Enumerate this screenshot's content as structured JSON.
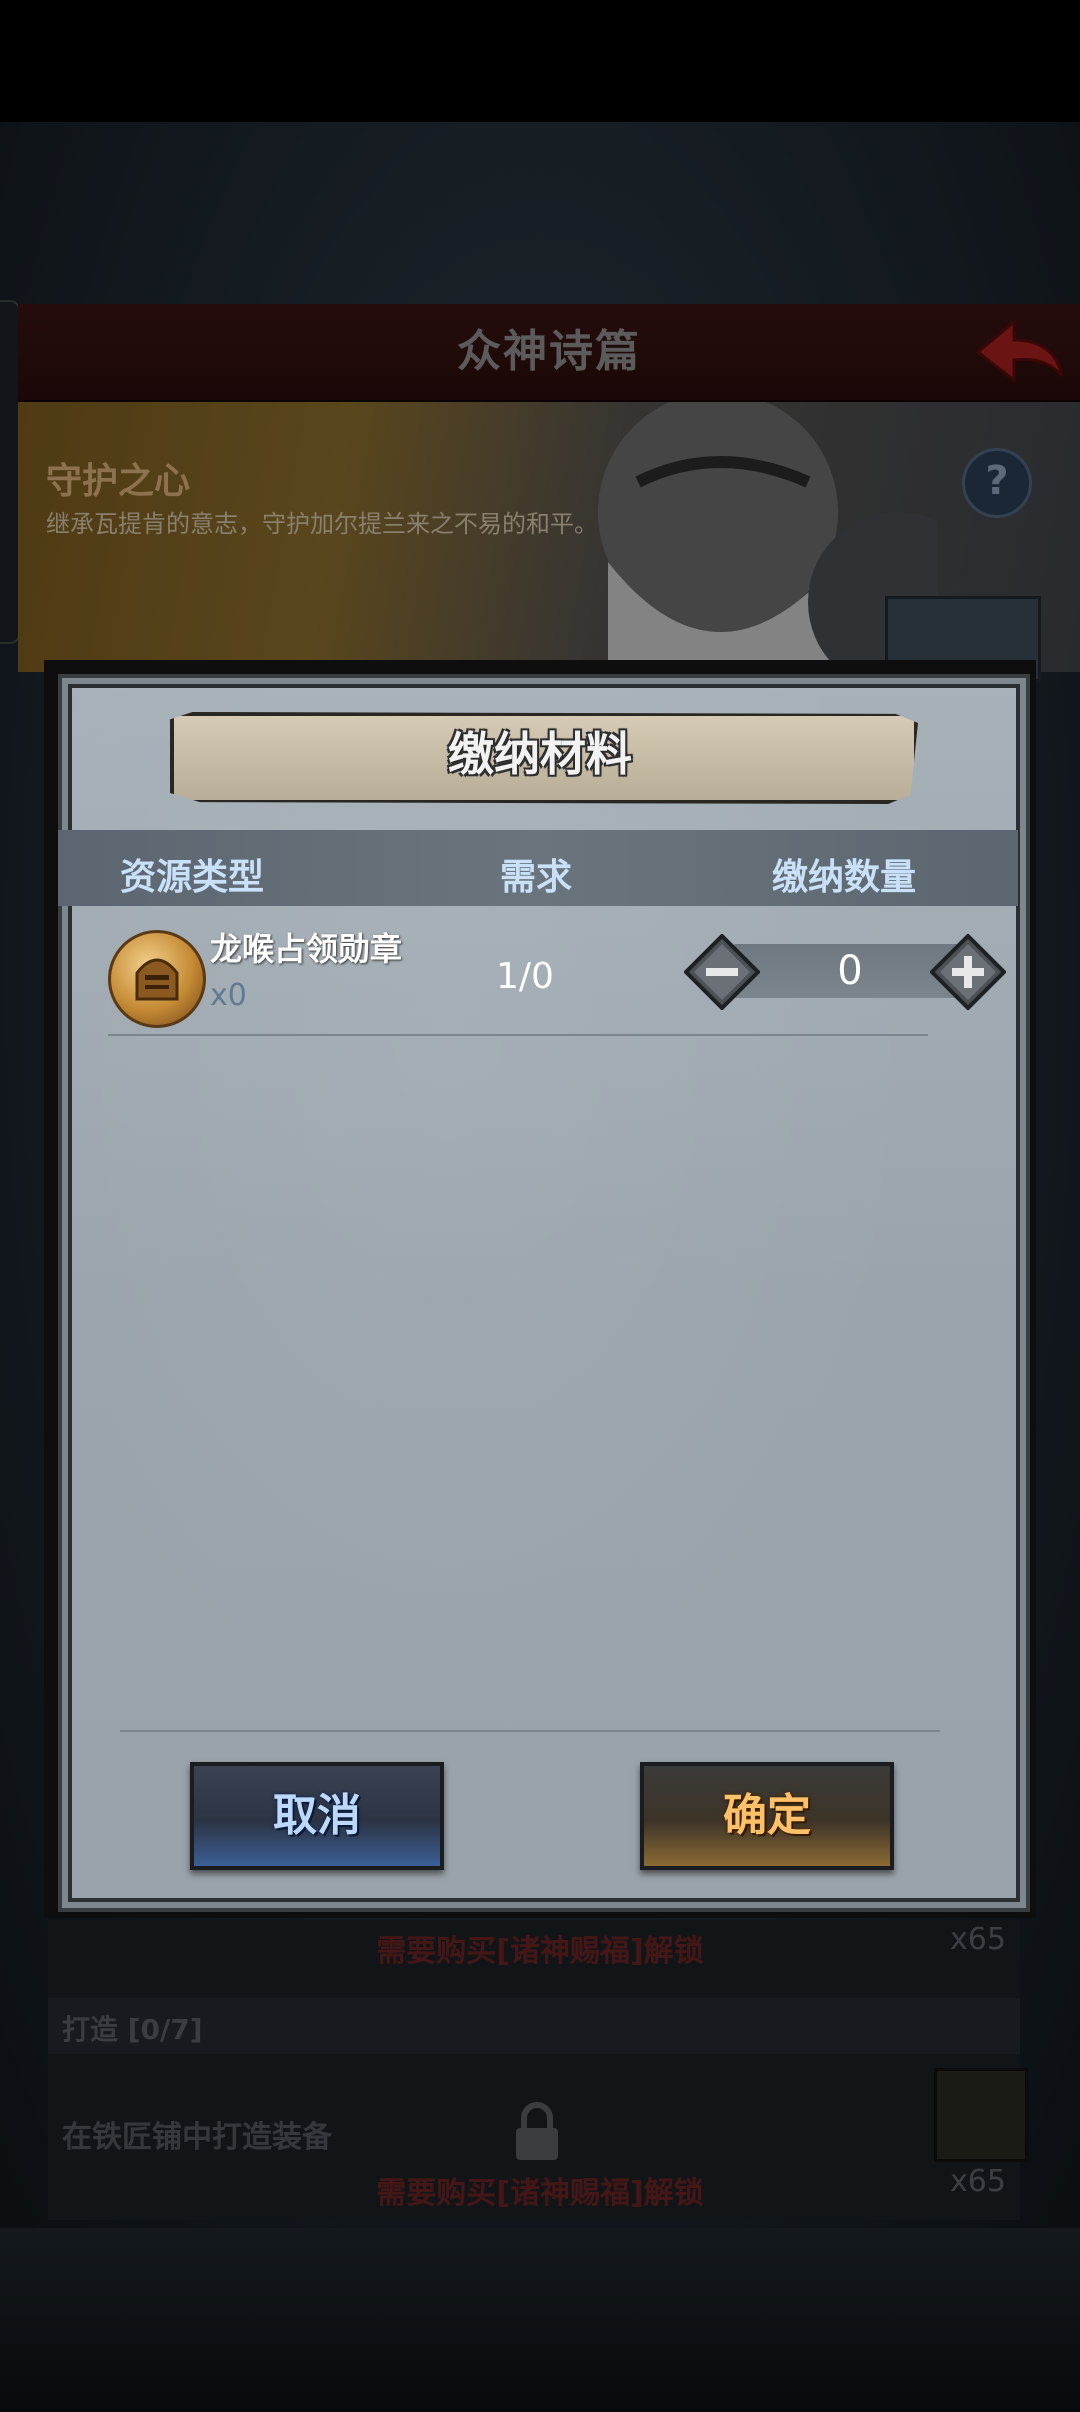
{
  "screen": {
    "title": "众神诗篇",
    "banner": {
      "title": "守护之心",
      "description": "继承瓦提肯的意志，守护加尔提兰来之不易的和平。"
    },
    "help_glyph": "?",
    "tasks": [
      {
        "lock_text": "需要购买[诸神赐福]解锁",
        "reward_count": "x65"
      },
      {
        "header": "打造 [0/7]",
        "description": "在铁匠铺中打造装备",
        "lock_text": "需要购买[诸神赐福]解锁",
        "reward_count": "x65"
      }
    ]
  },
  "dialog": {
    "title": "缴纳材料",
    "columns": {
      "resource": "资源类型",
      "need": "需求",
      "quantity": "缴纳数量"
    },
    "items": [
      {
        "name": "龙喉占领勋章",
        "owned": "x0",
        "need": "1/0",
        "quantity": "0"
      }
    ],
    "cancel_label": "取消",
    "confirm_label": "确定"
  },
  "colors": {
    "cancel_accent": "#3c5f96",
    "confirm_accent": "#8a6a34",
    "lock_text": "#6a2222",
    "header_text": "#c8e0f8"
  }
}
